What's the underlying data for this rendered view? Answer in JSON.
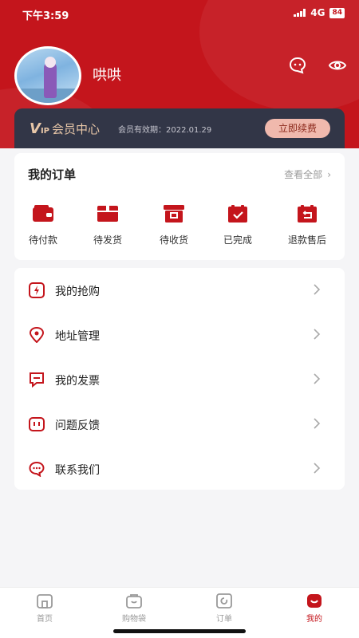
{
  "status_bar": {
    "time": "下午3:59",
    "network": "4G",
    "battery": "84"
  },
  "profile": {
    "username": "哄哄"
  },
  "vip": {
    "logo": "V",
    "logo_sub": "IP",
    "title": "会员中心",
    "validity": "会员有效期：2022.01.29",
    "renew_label": "立即续费"
  },
  "orders": {
    "title": "我的订单",
    "view_all": "查看全部",
    "items": [
      {
        "label": "待付款",
        "icon": "wallet-icon"
      },
      {
        "label": "待发货",
        "icon": "package-icon"
      },
      {
        "label": "待收货",
        "icon": "receive-box-icon"
      },
      {
        "label": "已完成",
        "icon": "completed-box-icon"
      },
      {
        "label": "退款售后",
        "icon": "refund-icon"
      }
    ]
  },
  "menu": {
    "items": [
      {
        "label": "我的抢购",
        "icon": "flash-sale-icon"
      },
      {
        "label": "地址管理",
        "icon": "location-icon"
      },
      {
        "label": "我的发票",
        "icon": "invoice-icon"
      },
      {
        "label": "问题反馈",
        "icon": "feedback-icon"
      },
      {
        "label": "联系我们",
        "icon": "contact-icon"
      }
    ]
  },
  "tabbar": {
    "items": [
      {
        "label": "首页",
        "icon": "home-icon"
      },
      {
        "label": "购物袋",
        "icon": "shopping-bag-icon"
      },
      {
        "label": "订单",
        "icon": "orders-icon"
      },
      {
        "label": "我的",
        "icon": "profile-icon"
      }
    ],
    "active": "我的"
  },
  "colors": {
    "brand": "#c4151c",
    "vip_bg": "#323647",
    "vip_gold": "#e8c7a8",
    "renew_bg": "#f0b9ad"
  }
}
